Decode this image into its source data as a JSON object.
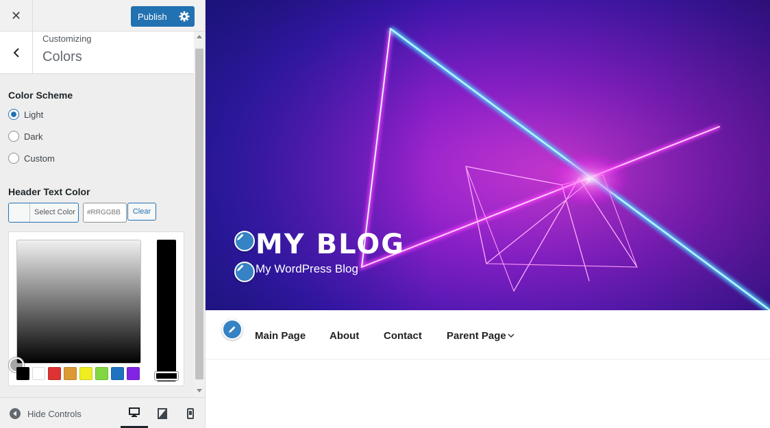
{
  "topbar": {
    "publish_label": "Publish"
  },
  "section": {
    "breadcrumb": "Customizing",
    "title": "Colors"
  },
  "color_scheme": {
    "title": "Color Scheme",
    "options": [
      {
        "label": "Light",
        "checked": true
      },
      {
        "label": "Dark",
        "checked": false
      },
      {
        "label": "Custom",
        "checked": false
      }
    ]
  },
  "header_text_color": {
    "title": "Header Text Color",
    "select_label": "Select Color",
    "hex_placeholder": "#RRGGBB",
    "clear_label": "Clear",
    "palette": [
      "#000000",
      "#ffffff",
      "#dd3333",
      "#dd9933",
      "#eeee22",
      "#81d742",
      "#1e73be",
      "#8224e3"
    ]
  },
  "footer": {
    "hide_controls_label": "Hide Controls"
  },
  "preview": {
    "site_title": "MY BLOG",
    "tagline": "My WordPress Blog",
    "menu": [
      "Main Page",
      "About",
      "Contact",
      "Parent Page"
    ]
  },
  "colors": {
    "accent": "#2271b1",
    "shortcut": "#3582c4"
  }
}
